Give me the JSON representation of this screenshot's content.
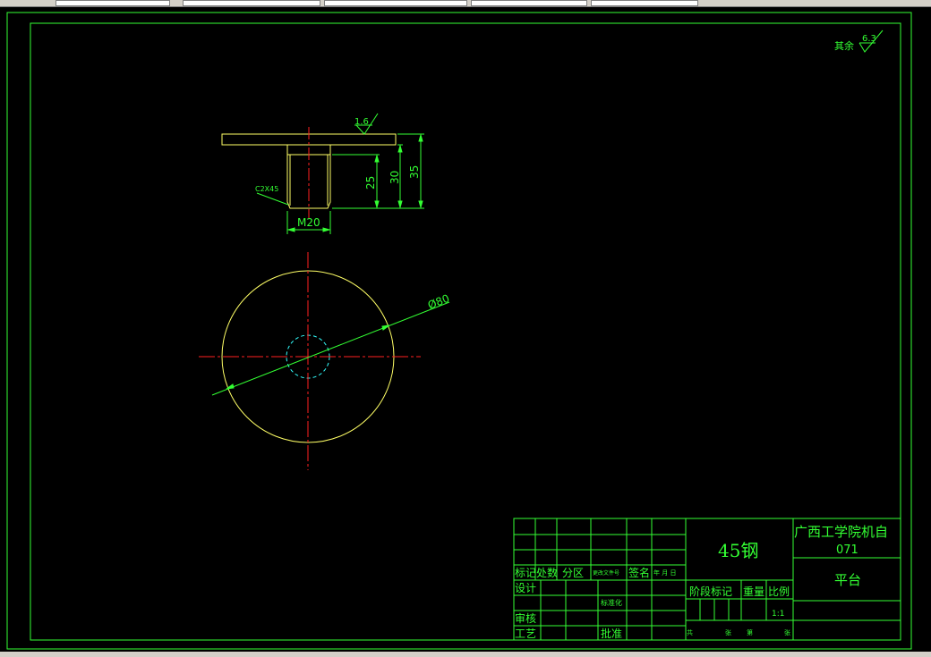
{
  "roughness": {
    "general_label": "其余",
    "general_value": "6.3",
    "surface_value": "1.6"
  },
  "dimensions": {
    "h25": "25",
    "h30": "30",
    "h35": "35",
    "thread": "M20",
    "chamfer": "C2X45",
    "diameter": "Ø80"
  },
  "title_block": {
    "material": "45钢",
    "school": "广西工学院机自",
    "class_code": "071",
    "part_name": "平台",
    "scale": "1:1",
    "headers": {
      "mark": "标记",
      "count": "处数",
      "zone": "分区",
      "change_doc": "更改文件号",
      "sign": "签名",
      "date": "年 月 日",
      "design": "设计",
      "standard": "标准化",
      "review": "审核",
      "process": "工艺",
      "approve": "批准",
      "stage_mark": "阶段标记",
      "weight": "重量",
      "ratio": "比例",
      "total": "共",
      "sheets": "张",
      "nth": "第",
      "sheet": "张"
    }
  },
  "colors": {
    "frame": "#33ff33",
    "part": "#ffff66",
    "center": "#ff2020",
    "hidden": "#33ffff"
  }
}
